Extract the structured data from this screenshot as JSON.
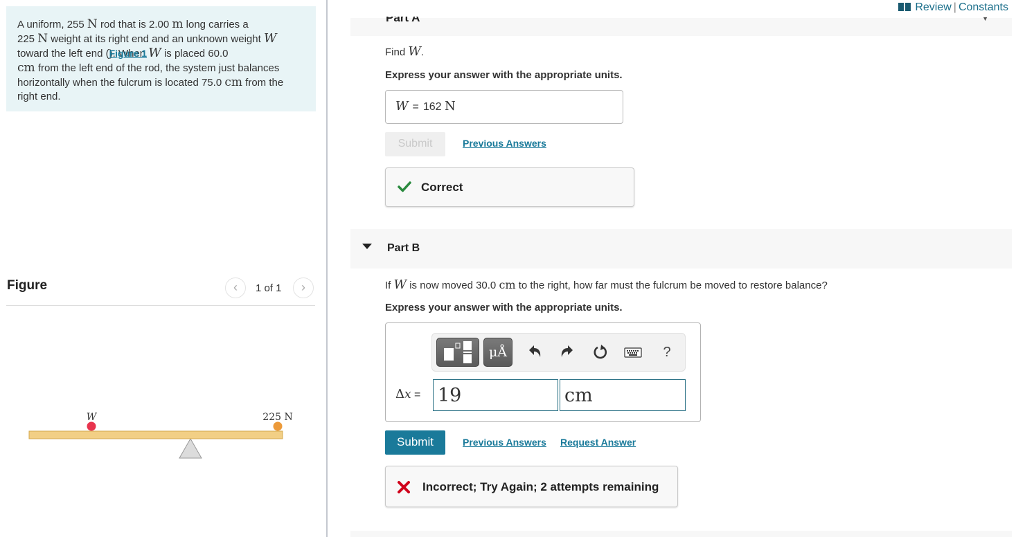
{
  "problem": {
    "t1": "A uniform, 255 ",
    "u1": "N",
    "t2": " rod that is 2.00 ",
    "u2": "m",
    "t3": " long carries a",
    "t4": "225 ",
    "u3": "N",
    "t5": " weight at its right end and an unknown weight ",
    "v1": "W",
    "t6": "toward the left end (",
    "figure_link": "Figure 1",
    "t7": "). When ",
    "v2": "W",
    "t8": " is placed 60.0",
    "u4": "cm",
    "t9": " from the left end of the rod, the system just balances",
    "t10": "horizontally when the fulcrum is located 75.0 ",
    "u5": "cm",
    "t11": " from the",
    "t12": "right end."
  },
  "figure_panel": {
    "title": "Figure",
    "counter": "1 of 1",
    "prev_glyph": "‹",
    "next_glyph": "›",
    "labels": {
      "weight_w": "W",
      "weight_right": "225 N"
    },
    "colors": {
      "rod": "#f2cf85",
      "rod_border": "#d4a94f",
      "w_ball": "#e8344e",
      "right_ball": "#ec9a3a",
      "fulcrum": "#dcdcdc"
    }
  },
  "header": {
    "review": "Review",
    "separator": "|",
    "constants": "Constants"
  },
  "partA": {
    "title": "Part A",
    "question_pre": "Find ",
    "question_var": "W",
    "question_post": ".",
    "instruction": "Express your answer with the appropriate units.",
    "answer_var": "W",
    "answer_eq": "=",
    "answer_value": "162",
    "answer_unit": "N",
    "submit_label": "Submit",
    "previous_answers": "Previous Answers",
    "feedback": "Correct",
    "feedback_color": "#2a8a3e"
  },
  "partB": {
    "title": "Part B",
    "question_pre": "If ",
    "question_var": "W",
    "question_mid": " is now moved 30.0 ",
    "question_unit": "cm",
    "question_post": " to the right, how far must the fulcrum be moved to restore balance?",
    "instruction": "Express your answer with the appropriate units.",
    "toolbar": {
      "units_label": "μÅ",
      "undo_icon": "undo-icon",
      "redo_icon": "redo-icon",
      "reset_icon": "reset-icon",
      "keyboard_icon": "keyboard-icon",
      "help_label": "?"
    },
    "label_delta": "Δ",
    "label_var": "x",
    "label_eq": " =",
    "value": "19",
    "unit": "cm",
    "submit_label": "Submit",
    "previous_answers": "Previous Answers",
    "request_answer": "Request Answer",
    "feedback": "Incorrect; Try Again; 2 attempts remaining",
    "feedback_color": "#d0021b"
  },
  "colors": {
    "accent": "#1a7a9a",
    "problem_bg": "#e8f4f6"
  }
}
